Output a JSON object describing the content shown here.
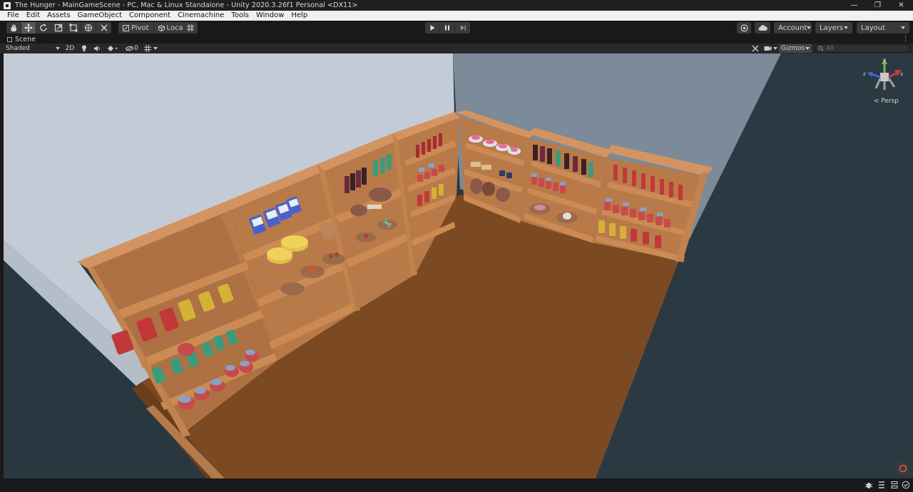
{
  "window": {
    "title": "The Hunger - MainGameScene - PC, Mac & Linux Standalone - Unity 2020.3.26f1 Personal <DX11>",
    "controls": [
      "minimize-icon",
      "restore-icon",
      "close-icon"
    ]
  },
  "menu": {
    "items": [
      "File",
      "Edit",
      "Assets",
      "GameObject",
      "Component",
      "Cinemachine",
      "Tools",
      "Window",
      "Help"
    ]
  },
  "toolbar": {
    "tools": [
      "hand-tool-icon",
      "move-tool-icon",
      "rotate-tool-icon",
      "scale-tool-icon",
      "rect-tool-icon",
      "transform-tool-icon",
      "custom-tool-icon"
    ],
    "active_tool": "move-tool-icon",
    "pivot_label": "Pivot",
    "local_label": "Local",
    "grid_snap_icon": "grid-snap-icon",
    "play_controls": [
      "play-icon",
      "pause-icon",
      "step-icon"
    ],
    "collab_icon": "collab-icon",
    "cloud_icon": "cloud-icon",
    "account_label": "Account",
    "layers_label": "Layers",
    "layout_label": "Layout"
  },
  "scene_panel": {
    "tab_label": "Scene",
    "shading_mode": "Shaded",
    "mode_2d": "2D",
    "hidden_count": "0",
    "gizmos_label": "Gizmos",
    "search_placeholder": "All",
    "persp_label": "< Persp",
    "gizmo_axes": {
      "y": "y",
      "z": "z",
      "x": "x"
    }
  },
  "colors": {
    "wall_left": "#c3cbd6",
    "wall_back": "#7c8a99",
    "floor": "#7c4a22",
    "shelf": "#cc8a55",
    "background": "#293840"
  }
}
